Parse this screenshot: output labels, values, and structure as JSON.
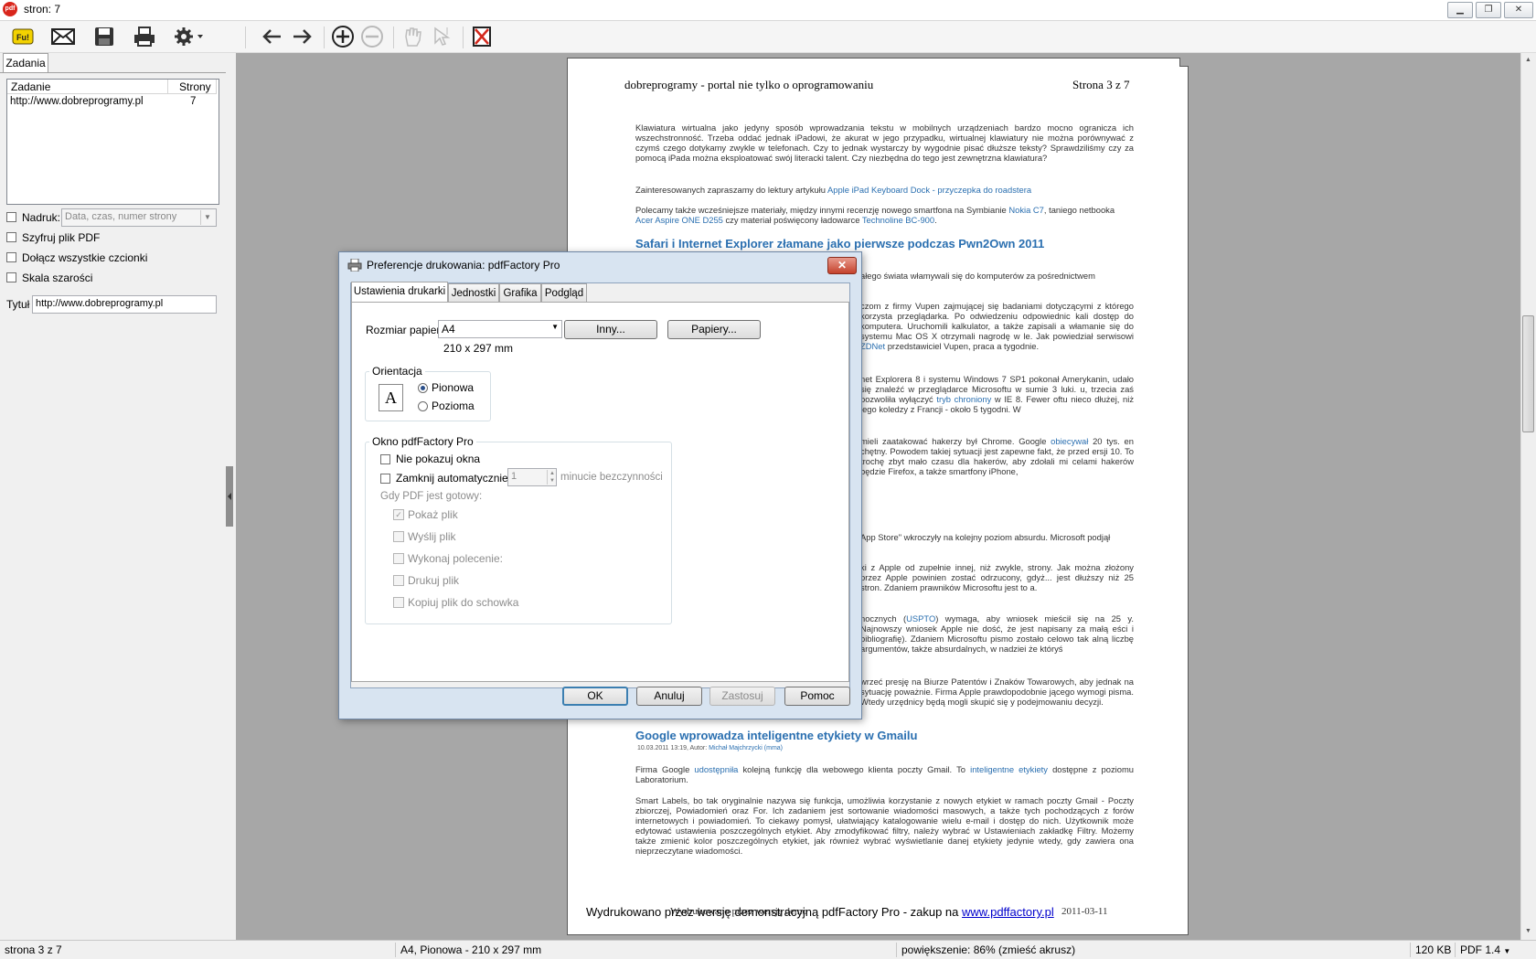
{
  "window": {
    "title": "stron: 7",
    "logo": "pdf"
  },
  "toolbar": {
    "icons": [
      "fun-icon",
      "mail-icon",
      "save-icon",
      "print-icon",
      "settings-icon",
      "back-arrow-icon",
      "forward-arrow-icon",
      "zoom-in-icon",
      "zoom-out-icon",
      "hand-tool-icon",
      "select-tool-icon",
      "delete-icon"
    ]
  },
  "left": {
    "tab": "Zadania",
    "list_headers": [
      "Zadanie",
      "Strony"
    ],
    "jobs": [
      {
        "name": "http://www.dobreprogramy.pl",
        "pages": "7"
      }
    ],
    "nadruk_label": "Nadruk:",
    "nadruk_placeholder": "Data, czas, numer strony",
    "opt_encrypt": "Szyfruj plik PDF",
    "opt_fonts": "Dołącz wszystkie czcionki",
    "opt_gray": "Skala szarości",
    "title_label": "Tytuł",
    "title_value": "http://www.dobreprogramy.pl"
  },
  "page": {
    "header_left": "dobreprogramy - portal nie tylko o oprogramowaniu",
    "header_right": "Strona 3 z 7",
    "p1": "Klawiatura wirtualna jako jedyny sposób wprowadzania tekstu w mobilnych urządzeniach bardzo mocno ogranicza ich wszechstronność. Trzeba oddać jednak iPadowi, że akurat w jego przypadku, wirtualnej klawiatury nie można porównywać z czymś czego dotykamy zwykle w telefonach. Czy to jednak wystarczy by wygodnie pisać dłuższe teksty? Sprawdziliśmy czy za pomocą iPada można eksploatować swój literacki talent. Czy niezbędna do tego jest zewnętrzna klawiatura?",
    "p2_text": "Zainteresowanych zapraszamy do lektury artykułu",
    "p2_link": "Apple iPad Keyboard Dock - przyczepka do roadstera",
    "p3_a": "Polecamy także wcześniejsze materiały, między innymi recenzję nowego smartfona na Symbianie",
    "p3_link1": "Nokia C7",
    "p3_b": ", taniego netbooka",
    "p3_link2": "Acer Aspire ONE D255",
    "p3_c": "czy materiał poświęcony ładowarce",
    "p3_link3": "Technoline BC-900",
    "p3_d": ".",
    "h1": "Safari i Internet Explorer złamane jako pierwsze podczas Pwn2Own 2011",
    "r1": "ałego świata włamywali się do komputerów za pośrednictwem",
    "r2": "czom z firmy Vupen zajmującej się badaniami dotyczącymi z którego korzysta przeglądarka. Po odwiedzeniu odpowiednic kali dostęp do komputera. Uruchomili kalkulator, a także zapisali a włamanie się do systemu Mac OS X otrzymali nagrodę w le. Jak powiedział serwisowi",
    "r2_link": "ZDNet",
    "r2_b": "przedstawiciel Vupen, praca a tygodnie.",
    "r3": "net Explorera 8 i systemu Windows 7 SP1 pokonał Amerykanin, udało się znaleźć w przeglądarce Microsoftu w sumie 3 luki. u, trzecia zaś pozwoliła wyłączyć",
    "r3_link": "tryb chroniony",
    "r3_b": "w IE 8. Fewer oftu nieco dłużej, niż jego koledzy z Francji - około 5 tygodni. W",
    "r4": "mieli zaatakować hakerzy był Chrome. Google",
    "r4_link": "obiecywał",
    "r4_b": "20 tys. en chętny. Powodem takiej sytuacji jest zapewne fakt, że przed ersji 10. To trochę zbyt mało czasu dla hakerów, aby zdołali mi celami hakerów będzie Firefox, a także smartfony iPhone,",
    "r5": "App Store\" wkroczyły na kolejny poziom absurdu. Microsoft podjął",
    "r6": "ki z Apple od zupełnie innej, niż zwykle, strony. Jak można złożony przez Apple powinien zostać odrzucony, gdyż... jest dłuższy niż 25 stron. Zdaniem prawników Microsoftu jest to a.",
    "r7_a": "nocznych (",
    "r7_link": "USPTO",
    "r7_b": ") wymaga, aby wniosek mieścił się na 25 y. Najnowszy wniosek Apple nie dość, że jest napisany za małą eści i bibliografię). Zdaniem Microsoftu pismo zostało celowo tak alną liczbę argumentów, także absurdalnych, w nadziei że któryś",
    "r8": "wrzeć presję na Biurze Patentów i Znaków Towarowych, aby jednak na sytuację poważnie. Firma Apple prawdopodobnie jącego wymogi pisma. Wtedy urzędnicy będą mogli skupić się y podejmowaniu decyzji.",
    "h2": "Google wprowadza inteligentne etykiety w Gmailu",
    "meta_a": "10.03.2011 13:19, Autor:",
    "meta_link": "Michał Majchrzycki (mma)",
    "g1_a": "Firma Google",
    "g1_link1": "udostępniła",
    "g1_b": "kolejną funkcję dla webowego klienta poczty Gmail. To",
    "g1_link2": "inteligentne etykiety",
    "g1_c": "dostępne z poziomu Laboratorium.",
    "g2": "Smart Labels, bo tak oryginalnie nazywa się funkcja, umożliwia korzystanie z nowych etykiet w ramach poczty Gmail - Poczty zbiorczej, Powiadomień oraz For. Ich zadaniem jest sortowanie wiadomości masowych, a także tych pochodzących z forów internetowych i powiadomień. To ciekawy pomysł, ułatwiający katalogowanie wielu e-mail i dostęp do nich. Użytkownik może edytować ustawienia poszczególnych etykiet. Aby zmodyfikować filtry, należy wybrać w Ustawieniach zakładkę Filtry. Możemy także zmienić kolor poszczególnych etykiet, jak również wybrać wyświetlanie danej etykiety jedynie wtedy, gdy zawiera ona nieprzeczytane wiadomości.",
    "footer_under": "Wydrukowano przez wersję demo",
    "footer_date": "2011-03-11",
    "watermark_text": "Wydrukowano przez wersję demonstracyjną pdfFactory Pro - zakup na",
    "watermark_link": "www.pdffactory.pl"
  },
  "status": {
    "page": "strona 3 z 7",
    "paper": "A4, Pionowa - 210 x 297 mm",
    "zoom": "powiększenie: 86% (zmieść akrusz)",
    "size": "120 KB",
    "pdf": "PDF 1.4"
  },
  "dialog": {
    "title": "Preferencje drukowania: pdfFactory Pro",
    "close": "✕",
    "tabs": [
      "Ustawienia drukarki",
      "Jednostki",
      "Grafika",
      "Podgląd"
    ],
    "paper_label": "Rozmiar papieru:",
    "paper_value": "A4",
    "paper_dims": "210 x 297 mm",
    "btn_other": "Inny...",
    "btn_papers": "Papiery...",
    "orient_title": "Orientacja",
    "orient_icon": "A",
    "portrait": "Pionowa",
    "landscape": "Pozioma",
    "window_title": "Okno pdfFactory Pro",
    "dont_show": "Nie pokazuj okna",
    "auto_close": "Zamknij automatycznie po",
    "auto_close_value": "1",
    "auto_close_suffix": "minucie bezczynności",
    "when_ready": "Gdy PDF jest gotowy:",
    "show_file": "Pokaż plik",
    "send_file": "Wyślij plik",
    "run_cmd": "Wykonaj polecenie:",
    "print_file": "Drukuj plik",
    "copy_clip": "Kopiuj plik do schowka",
    "ok": "OK",
    "cancel": "Anuluj",
    "apply": "Zastosuj",
    "help": "Pomoc"
  }
}
